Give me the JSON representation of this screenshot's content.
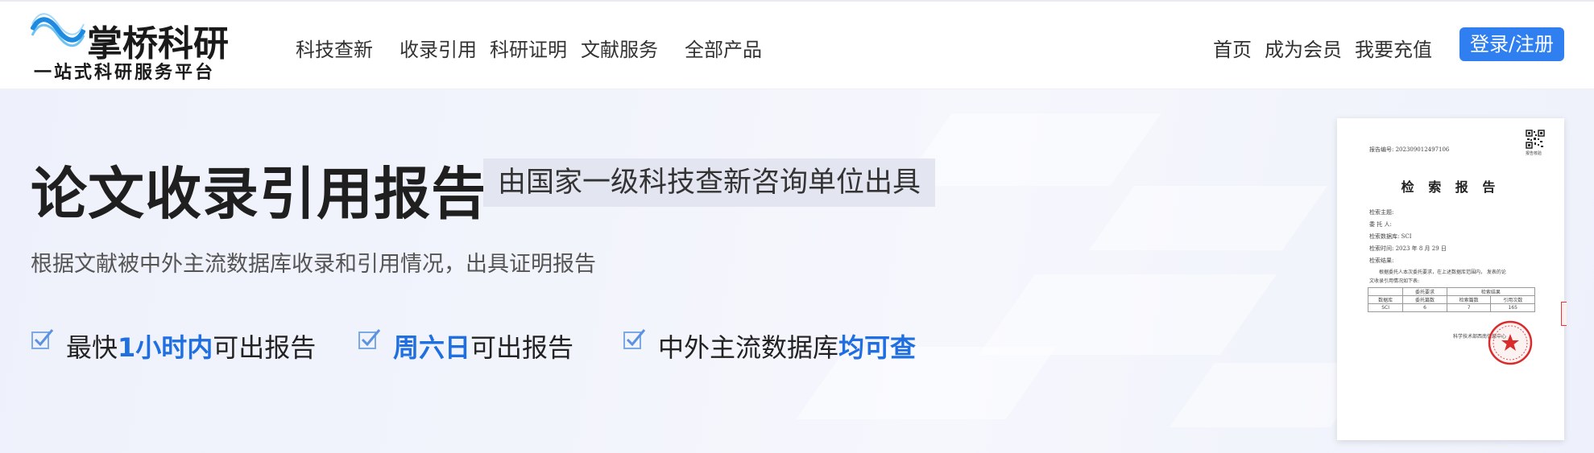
{
  "header": {
    "logo_text": "掌桥科研",
    "logo_slogan": "一站式科研服务平台",
    "nav_left": [
      {
        "label": "科技查新"
      },
      {
        "label": "收录引用"
      },
      {
        "label": "科研证明"
      },
      {
        "label": "文献服务"
      },
      {
        "label": "全部产品"
      }
    ],
    "nav_right": [
      {
        "label": "首页"
      },
      {
        "label": "成为会员"
      },
      {
        "label": "我要充值"
      }
    ],
    "login_label": "登录/注册"
  },
  "hero": {
    "title": "论文收录引用报告",
    "tag": "由国家一级科技查新咨询单位出具",
    "subtitle": "根据文献被中外主流数据库收录和引用情况，出具证明报告",
    "features": [
      {
        "pre": "最快",
        "highlight": "1小时内",
        "post": "可出报告"
      },
      {
        "pre": "",
        "highlight": "周六日",
        "post": "可出报告"
      },
      {
        "pre": "中外主流数据库",
        "highlight": "均可查",
        "post": ""
      }
    ]
  },
  "report_preview": {
    "serial": "报告编号: 202309012497106",
    "qr_caption": "报告核验",
    "title": "检 索 报 告",
    "fields": [
      "检索主题:",
      "委 托 人:",
      "检索数据库: SCI",
      "检索时间: 2023 年 8 月 29 日",
      "检索结果:"
    ],
    "body_line1": "根据委托人本次委托要求，在上述数据库范围内，    发表的论",
    "body_line2": "文收录引用情况如下表:",
    "table_groups": [
      "委托要求",
      "检索结果"
    ],
    "table_headers": [
      "数据库",
      "委托篇数",
      "检索篇数",
      "引用次数"
    ],
    "table_row": [
      "SCI",
      "6",
      "7",
      "165"
    ],
    "footer": "科学技术部西南信息中心",
    "stamp_text": "科学技术部西南信息中心 检索专用章"
  },
  "colors": {
    "accent": "#2f7ff0",
    "highlight": "#1f6fe0",
    "stamp": "#d92b2b"
  }
}
